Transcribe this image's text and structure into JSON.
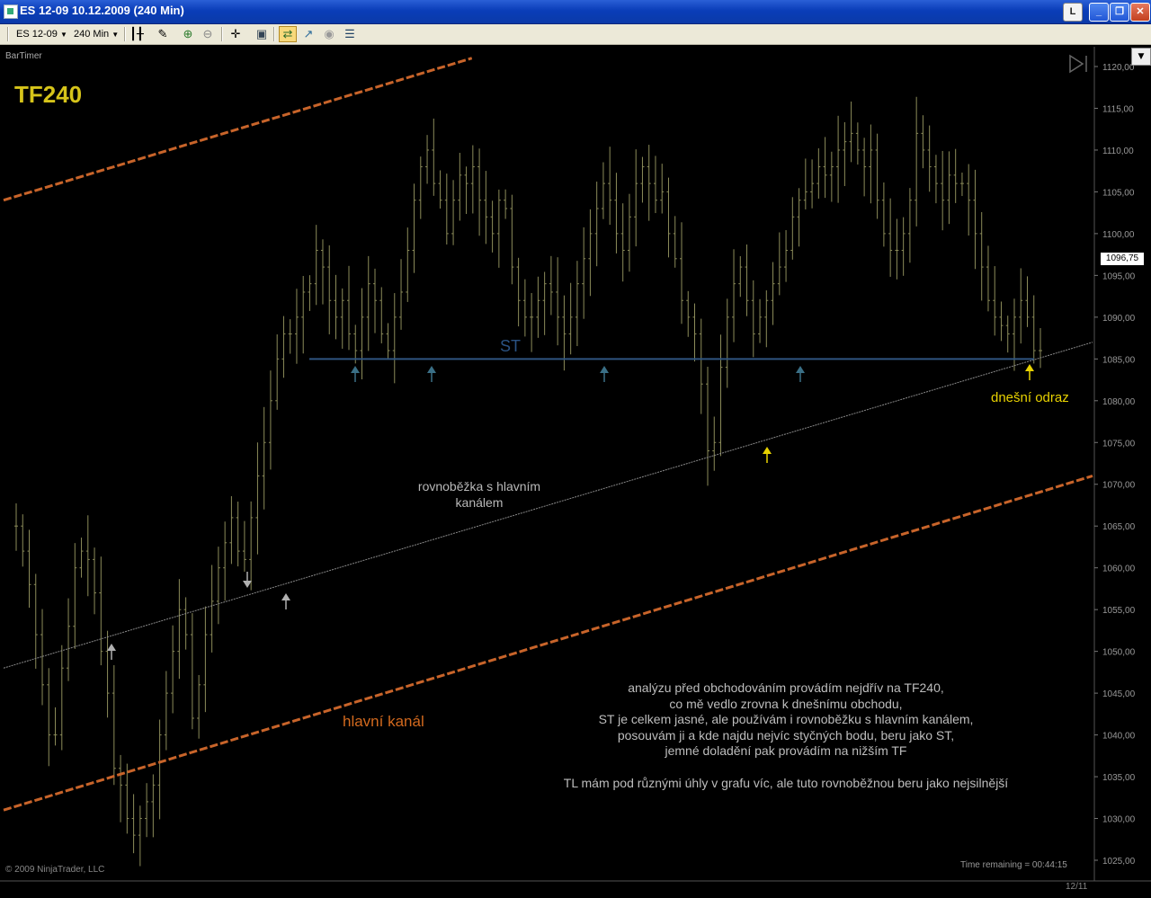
{
  "window": {
    "title": "ES 12-09  10.12.2009 (240 Min)",
    "btn_l": "L",
    "btn_min": "_",
    "btn_max": "❐",
    "btn_close": "✕"
  },
  "toolbar": {
    "instrument": "ES 12-09",
    "interval": "240 Min",
    "icons": [
      "bar-style-icon",
      "draw-tool-icon",
      "zoom-in-icon",
      "zoom-out-icon",
      "crosshair-icon",
      "properties-icon",
      "data-series-icon",
      "indicators-icon",
      "strategy-icon",
      "data-box-icon"
    ]
  },
  "chart_labels": {
    "bartimer": "BarTimer",
    "timeframe": "TF240",
    "copyright": "© 2009 NinjaTrader, LLC",
    "time_remaining": "Time remaining = 00:44:15",
    "st_label": "ST",
    "today_bounce": "dnešní odraz",
    "parallel": "rovnoběžka s hlavním kanálem",
    "main_channel": "hlavní kanál",
    "analysis_lines": [
      "analýzu před obchodováním provádím nejdřív na TF240,",
      "co mě vedlo zrovna k dnešnímu obchodu,",
      "ST je celkem jasné, ale používám i rovnoběžku s hlavním kanálem,",
      "posouvám ji a kde najdu nejvíc styčných bodu, beru jako ST,",
      "jemné doladění pak provádím na nižším TF"
    ],
    "analysis_last": "TL mám pod různými úhly v grafu víc, ale tuto rovnoběžnou beru jako nejsilnější",
    "current_price": "1096,75",
    "date_tick": "12/11"
  },
  "chart_data": {
    "type": "ohlc",
    "ylim": [
      1025,
      1121
    ],
    "y_ticks": [
      "1120,00",
      "1115,00",
      "1110,00",
      "1105,00",
      "1100,00",
      "1095,00",
      "1090,00",
      "1085,00",
      "1080,00",
      "1075,00",
      "1070,00",
      "1065,00",
      "1060,00",
      "1055,00",
      "1050,00",
      "1045,00",
      "1040,00",
      "1035,00",
      "1030,00",
      "1025,00"
    ],
    "current_price": 1096.75,
    "bar_color": "#8c8c5a",
    "price_path": [
      1065,
      1062,
      1058,
      1052,
      1046,
      1040,
      1040,
      1048,
      1053,
      1060,
      1062,
      1061,
      1057,
      1050,
      1045,
      1036,
      1034,
      1030,
      1028,
      1030,
      1032,
      1034,
      1040,
      1045,
      1050,
      1055,
      1052,
      1042,
      1046,
      1052,
      1056,
      1060,
      1063,
      1066,
      1062,
      1061,
      1066,
      1071,
      1075,
      1080,
      1085,
      1088,
      1088,
      1090,
      1093,
      1094,
      1098,
      1096,
      1092,
      1090,
      1092,
      1088,
      1086,
      1090,
      1094,
      1092,
      1088,
      1086,
      1090,
      1093,
      1098,
      1104,
      1108,
      1110,
      1106,
      1104,
      1100,
      1104,
      1107,
      1106,
      1108,
      1104,
      1102,
      1100,
      1104,
      1103,
      1096,
      1092,
      1090,
      1090,
      1092,
      1094,
      1093,
      1090,
      1088,
      1090,
      1094,
      1097,
      1100,
      1103,
      1106,
      1104,
      1100,
      1098,
      1102,
      1106,
      1108,
      1106,
      1104,
      1105,
      1100,
      1097,
      1092,
      1090,
      1088,
      1082,
      1074,
      1075,
      1084,
      1090,
      1094,
      1096,
      1092,
      1088,
      1090,
      1092,
      1094,
      1096,
      1098,
      1102,
      1104,
      1105,
      1106,
      1108,
      1107,
      1108,
      1110,
      1111,
      1112,
      1110,
      1108,
      1110,
      1104,
      1100,
      1098,
      1098,
      1100,
      1104,
      1112,
      1110,
      1108,
      1106,
      1104,
      1107,
      1106,
      1106,
      1104,
      1100,
      1096,
      1092,
      1090,
      1089,
      1088,
      1090,
      1092,
      1090,
      1086,
      1086
    ],
    "st_level": 1085,
    "upper_channel": {
      "x1": 0,
      "y1": 1104,
      "x2": 0.43,
      "y2": 1121
    },
    "lower_channel": {
      "x1": 0,
      "y1": 1031,
      "x2": 1,
      "y2": 1071
    },
    "parallel_line": {
      "x1": 0,
      "y1": 1048,
      "x2": 1,
      "y2": 1087
    },
    "colors": {
      "channel": "#c8642a",
      "st": "#2f5480",
      "parallel": "#8a8a8a",
      "arrow_up_teal": "#3a6f86",
      "arrow_yellow": "#e8d200",
      "arrow_gray": "#b0b0b0"
    }
  }
}
